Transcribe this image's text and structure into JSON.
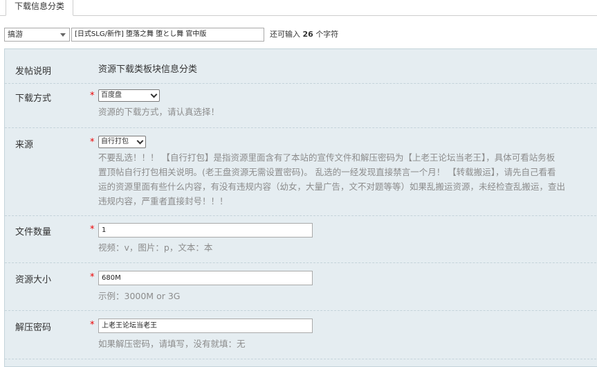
{
  "tabs": {
    "active": "下载信息分类"
  },
  "top": {
    "category": "搞游",
    "title_value": "[日式SLG/新作] 堕落之舞 堕とし舞 官中版",
    "remain_prefix": "还可输入",
    "remain_count": "26",
    "remain_suffix": "个字符"
  },
  "form": {
    "intro": {
      "label": "发帖说明",
      "text": "资源下载类板块信息分类"
    },
    "download_method": {
      "label": "下载方式",
      "required": "*",
      "value": "百度盘",
      "help": "资源的下载方式，请认真选择！"
    },
    "source": {
      "label": "来源",
      "required": "*",
      "value": "自行打包",
      "help": [
        "不要乱选！！！ 【自行打包】是指资源里面含有了本站的宣传文件和解压密码为【上老王论坛当老王】，具体可看站务板",
        "置顶帖自行打包相关说明。(老王盘资源无需设置密码)。 乱选的一经发现直接禁言一个月！ 【转载搬运】，请先自己看看",
        "运的资源里面有些什么内容，有没有违规内容（幼女，大量广告，文不对题等等）如果乱搬运资源，未经检查乱搬运，查出",
        "违规内容，严重者直接封号！！！"
      ]
    },
    "file_count": {
      "label": "文件数量",
      "required": "*",
      "value": "1",
      "help": "视频：v，图片：p，文本：本"
    },
    "size": {
      "label": "资源大小",
      "required": "*",
      "value": "680M",
      "help": "示例：3000M or 3G"
    },
    "password": {
      "label": "解压密码",
      "required": "*",
      "value": "上老王论坛当老王",
      "help": "如果解压密码，请填写，没有就填：无"
    }
  }
}
